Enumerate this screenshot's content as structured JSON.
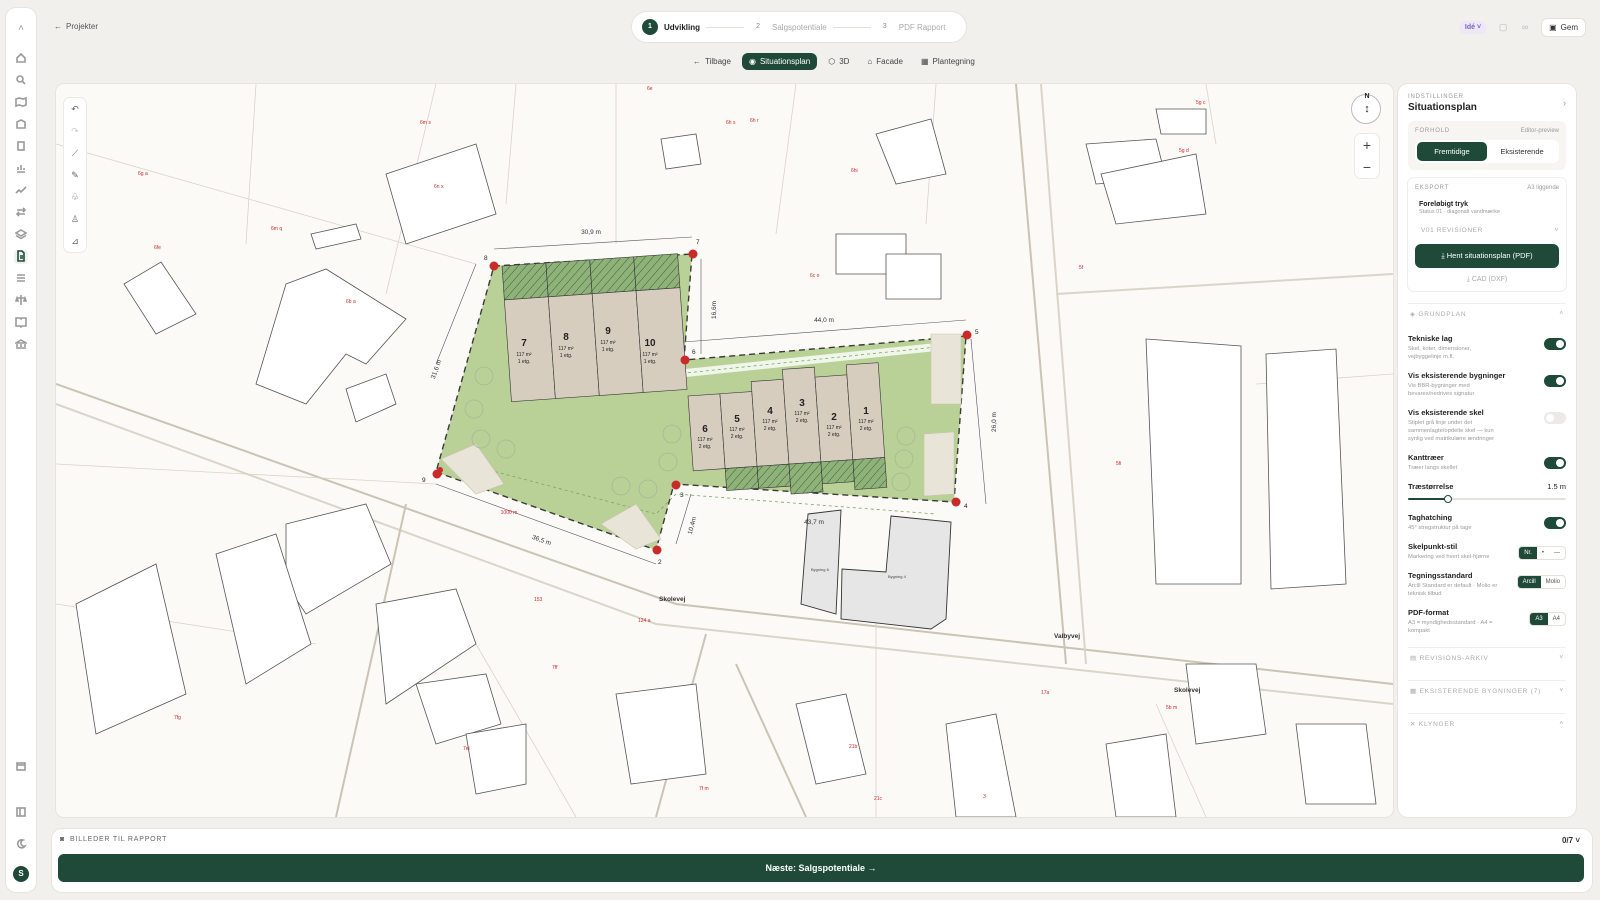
{
  "nav": {
    "back_label": "Projekter"
  },
  "stepper": [
    {
      "num": "1",
      "label": "Udvikling",
      "active": true
    },
    {
      "num": "2",
      "label": "Salgspotentiale",
      "active": false
    },
    {
      "num": "3",
      "label": "PDF Rapport",
      "active": false
    }
  ],
  "top_right": {
    "idea_label": "Idé",
    "save_label": "Gem"
  },
  "view_tabs": [
    {
      "label": "Tilbage",
      "active": false,
      "icon": "arrow-left-icon"
    },
    {
      "label": "Situationsplan",
      "active": true,
      "icon": "eye-icon"
    },
    {
      "label": "3D",
      "active": false,
      "icon": "cube-icon"
    },
    {
      "label": "Facade",
      "active": false,
      "icon": "house-icon"
    },
    {
      "label": "Plantegning",
      "active": false,
      "icon": "grid-icon"
    }
  ],
  "map": {
    "compass_label": "N",
    "street_labels": [
      "Skolevej",
      "Valbyvej",
      "Skolevej"
    ],
    "dimension_labels": [
      "30,9 m",
      "44,0 m",
      "31,6 m",
      "16,6m",
      "26,0 m",
      "36,5 m",
      "10,4m",
      "43,7 m",
      "1000 m"
    ],
    "boundary_points": [
      "1",
      "2",
      "3",
      "4",
      "5",
      "6",
      "7",
      "8",
      "9"
    ],
    "cadastral_labels": [
      "6m s",
      "6n x",
      "6m q",
      "6fe",
      "6g a",
      "6e",
      "6h s",
      "6h r",
      "6hi",
      "6c o",
      "5f",
      "5g c",
      "5g d",
      "5fi",
      "6b a",
      "153",
      "124 a",
      "7ff",
      "7fg",
      "7ei",
      "21b",
      "21c",
      "7f m",
      "17a",
      "5b m",
      "3"
    ],
    "existing_buildings": [
      "Bygning 6",
      "Bygning 4"
    ],
    "units_top": [
      {
        "no": "7",
        "area": "117 m²",
        "floors": "1 etg."
      },
      {
        "no": "8",
        "area": "117 m²",
        "floors": "1 etg."
      },
      {
        "no": "9",
        "area": "117 m²",
        "floors": "1 etg."
      },
      {
        "no": "10",
        "area": "117 m²",
        "floors": "1 etg."
      }
    ],
    "units_bottom": [
      {
        "no": "6",
        "area": "117 m²",
        "floors": "2 etg."
      },
      {
        "no": "5",
        "area": "117 m²",
        "floors": "2 etg."
      },
      {
        "no": "4",
        "area": "117 m²",
        "floors": "2 etg."
      },
      {
        "no": "3",
        "area": "117 m²",
        "floors": "2 etg."
      },
      {
        "no": "2",
        "area": "117 m²",
        "floors": "2 etg."
      },
      {
        "no": "1",
        "area": "117 m²",
        "floors": "2 etg."
      }
    ]
  },
  "panel": {
    "kicker": "INDSTILLINGER",
    "title": "Situationsplan",
    "forhold": {
      "label": "FORHOLD",
      "hint": "Editor-preview",
      "options": [
        "Fremtidige",
        "Eksisterende"
      ],
      "selected": "Fremtidige"
    },
    "eksport": {
      "label": "EKSPORT",
      "hint": "A3 liggende",
      "item_title": "Foreløbigt tryk",
      "item_sub": "Status 01 · diagonalt vandmærke",
      "revision": "V01   REVISIONER",
      "download_label": "Hent situationsplan (PDF)",
      "cad_label": "CAD (DXF)"
    },
    "grundplan_label": "GRUNDPLAN",
    "settings": [
      {
        "label": "Tekniske lag",
        "desc": "Skel, koter, dimensioner, vejbyggelinje m.fl.",
        "on": true
      },
      {
        "label": "Vis eksisterende bygninger",
        "desc": "Vis BBR-bygninger med bevares/nedrives signatur",
        "on": true
      },
      {
        "label": "Vis eksisterende skel",
        "desc": "Stiplet grå linje under det sammenlagte/opdelte skel — kun synlig ved matrikulære ændringer",
        "on": false
      },
      {
        "label": "Kanttræer",
        "desc": "Træer langs skellet",
        "on": true
      }
    ],
    "tree_size": {
      "label": "Træstørrelse",
      "value": "1.5 m",
      "fraction": 0.25
    },
    "taghatching": {
      "label": "Taghatching",
      "desc": "45° stregstruktur på tage",
      "on": true
    },
    "skelpunkt": {
      "label": "Skelpunkt-stil",
      "desc": "Markering ved hvert skel-hjørne",
      "options": [
        "Nr.",
        "•",
        "—"
      ],
      "selected": "Nr."
    },
    "tegning": {
      "label": "Tegningsstandard",
      "desc": "Arcill Standard er default · Molio er teknisk tilbud",
      "options": [
        "Arcill",
        "Molio"
      ],
      "selected": "Arcill"
    },
    "pdf": {
      "label": "PDF-format",
      "desc": "A3 = myndighedsstandard · A4 = kompakt",
      "options": [
        "A3",
        "A4"
      ],
      "selected": "A3"
    },
    "revisions_arkiv": "REVISIONS-ARKIV",
    "eksisterende": "EKSISTERENDE BYGNINGER (7)",
    "klynger": "KLYNGER"
  },
  "footer": {
    "images_label": "BILLEDER TIL RAPPORT",
    "count": "0/7",
    "next_label": "Næste: Salgspotentiale →"
  },
  "colors": {
    "accent": "#1f4a3a",
    "site_green": "#b9d196",
    "point_red": "#c92a2a"
  }
}
